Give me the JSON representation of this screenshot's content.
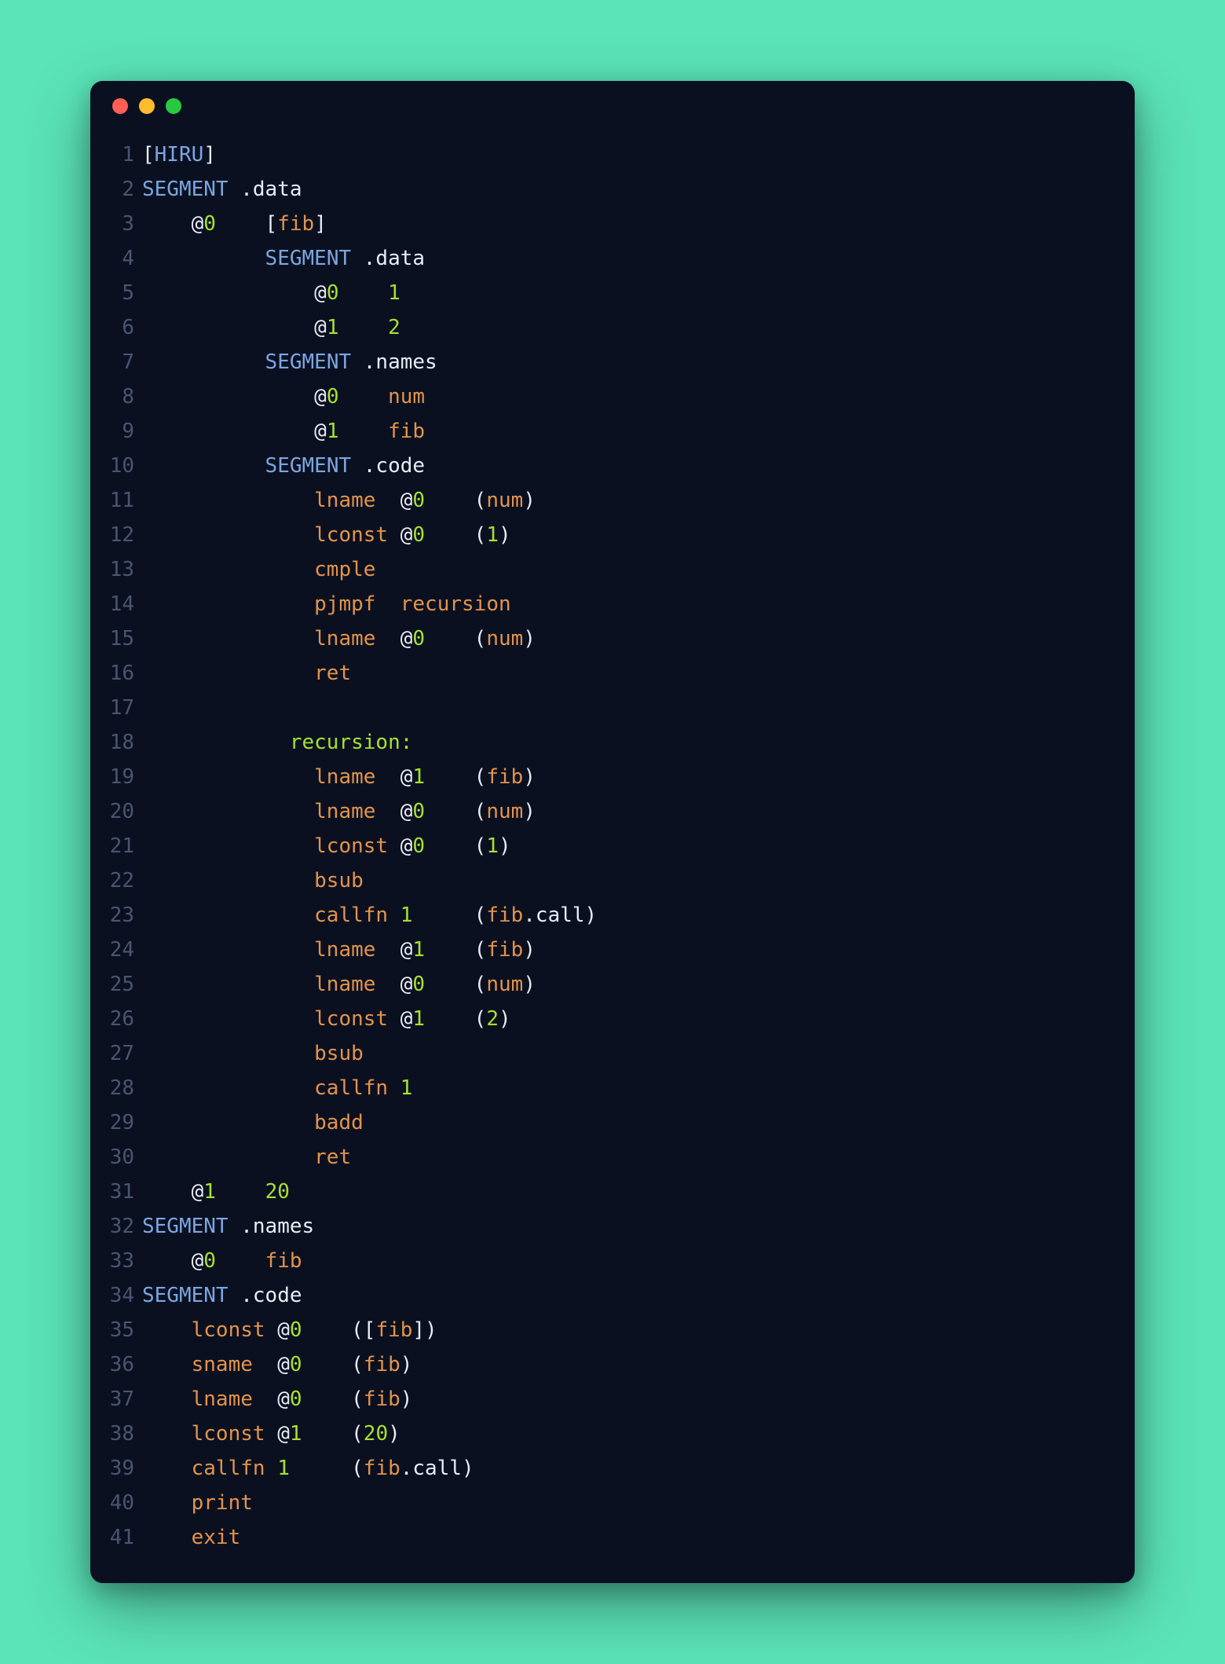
{
  "window": {
    "traffic_lights": [
      "red",
      "yellow",
      "green"
    ]
  },
  "colors": {
    "background_page": "#5be4b8",
    "background_window": "#0b1021",
    "text_default": "#d7dbe6",
    "text_gutter": "#4a5570",
    "syntax": {
      "white": "#e8ecf5",
      "blue": "#7aa7e0",
      "green": "#a6e22e",
      "orange": "#e2944a",
      "gray": "#788097"
    }
  },
  "lines": [
    {
      "n": "1",
      "tokens": [
        {
          "t": "[",
          "c": "white"
        },
        {
          "t": "HIRU",
          "c": "blue"
        },
        {
          "t": "]",
          "c": "white"
        }
      ]
    },
    {
      "n": "2",
      "tokens": [
        {
          "t": "SEGMENT",
          "c": "blue"
        },
        {
          "t": " .data",
          "c": "white"
        }
      ]
    },
    {
      "n": "3",
      "tokens": [
        {
          "t": "    @",
          "c": "white"
        },
        {
          "t": "0",
          "c": "green"
        },
        {
          "t": "    [",
          "c": "white"
        },
        {
          "t": "fib",
          "c": "orange"
        },
        {
          "t": "]",
          "c": "white"
        }
      ]
    },
    {
      "n": "4",
      "tokens": [
        {
          "t": "          ",
          "c": "white"
        },
        {
          "t": "SEGMENT",
          "c": "blue"
        },
        {
          "t": " .data",
          "c": "white"
        }
      ]
    },
    {
      "n": "5",
      "tokens": [
        {
          "t": "              @",
          "c": "white"
        },
        {
          "t": "0",
          "c": "green"
        },
        {
          "t": "    ",
          "c": "white"
        },
        {
          "t": "1",
          "c": "green"
        }
      ]
    },
    {
      "n": "6",
      "tokens": [
        {
          "t": "              @",
          "c": "white"
        },
        {
          "t": "1",
          "c": "green"
        },
        {
          "t": "    ",
          "c": "white"
        },
        {
          "t": "2",
          "c": "green"
        }
      ]
    },
    {
      "n": "7",
      "tokens": [
        {
          "t": "          ",
          "c": "white"
        },
        {
          "t": "SEGMENT",
          "c": "blue"
        },
        {
          "t": " .names",
          "c": "white"
        }
      ]
    },
    {
      "n": "8",
      "tokens": [
        {
          "t": "              @",
          "c": "white"
        },
        {
          "t": "0",
          "c": "green"
        },
        {
          "t": "    ",
          "c": "white"
        },
        {
          "t": "num",
          "c": "orange"
        }
      ]
    },
    {
      "n": "9",
      "tokens": [
        {
          "t": "              @",
          "c": "white"
        },
        {
          "t": "1",
          "c": "green"
        },
        {
          "t": "    ",
          "c": "white"
        },
        {
          "t": "fib",
          "c": "orange"
        }
      ]
    },
    {
      "n": "10",
      "tokens": [
        {
          "t": "          ",
          "c": "white"
        },
        {
          "t": "SEGMENT",
          "c": "blue"
        },
        {
          "t": " .code",
          "c": "white"
        }
      ]
    },
    {
      "n": "11",
      "tokens": [
        {
          "t": "              ",
          "c": "white"
        },
        {
          "t": "lname",
          "c": "orange"
        },
        {
          "t": "  @",
          "c": "white"
        },
        {
          "t": "0",
          "c": "green"
        },
        {
          "t": "    (",
          "c": "white"
        },
        {
          "t": "num",
          "c": "orange"
        },
        {
          "t": ")",
          "c": "white"
        }
      ]
    },
    {
      "n": "12",
      "tokens": [
        {
          "t": "              ",
          "c": "white"
        },
        {
          "t": "lconst",
          "c": "orange"
        },
        {
          "t": " @",
          "c": "white"
        },
        {
          "t": "0",
          "c": "green"
        },
        {
          "t": "    (",
          "c": "white"
        },
        {
          "t": "1",
          "c": "green"
        },
        {
          "t": ")",
          "c": "white"
        }
      ]
    },
    {
      "n": "13",
      "tokens": [
        {
          "t": "              ",
          "c": "white"
        },
        {
          "t": "cmple",
          "c": "orange"
        }
      ]
    },
    {
      "n": "14",
      "tokens": [
        {
          "t": "              ",
          "c": "white"
        },
        {
          "t": "pjmpf",
          "c": "orange"
        },
        {
          "t": "  ",
          "c": "white"
        },
        {
          "t": "recursion",
          "c": "orange"
        }
      ]
    },
    {
      "n": "15",
      "tokens": [
        {
          "t": "              ",
          "c": "white"
        },
        {
          "t": "lname",
          "c": "orange"
        },
        {
          "t": "  @",
          "c": "white"
        },
        {
          "t": "0",
          "c": "green"
        },
        {
          "t": "    (",
          "c": "white"
        },
        {
          "t": "num",
          "c": "orange"
        },
        {
          "t": ")",
          "c": "white"
        }
      ]
    },
    {
      "n": "16",
      "tokens": [
        {
          "t": "              ",
          "c": "white"
        },
        {
          "t": "ret",
          "c": "orange"
        }
      ]
    },
    {
      "n": "17",
      "tokens": [
        {
          "t": "",
          "c": "white"
        }
      ]
    },
    {
      "n": "18",
      "tokens": [
        {
          "t": "            ",
          "c": "white"
        },
        {
          "t": "recursion:",
          "c": "green"
        }
      ]
    },
    {
      "n": "19",
      "tokens": [
        {
          "t": "              ",
          "c": "white"
        },
        {
          "t": "lname",
          "c": "orange"
        },
        {
          "t": "  @",
          "c": "white"
        },
        {
          "t": "1",
          "c": "green"
        },
        {
          "t": "    (",
          "c": "white"
        },
        {
          "t": "fib",
          "c": "orange"
        },
        {
          "t": ")",
          "c": "white"
        }
      ]
    },
    {
      "n": "20",
      "tokens": [
        {
          "t": "              ",
          "c": "white"
        },
        {
          "t": "lname",
          "c": "orange"
        },
        {
          "t": "  @",
          "c": "white"
        },
        {
          "t": "0",
          "c": "green"
        },
        {
          "t": "    (",
          "c": "white"
        },
        {
          "t": "num",
          "c": "orange"
        },
        {
          "t": ")",
          "c": "white"
        }
      ]
    },
    {
      "n": "21",
      "tokens": [
        {
          "t": "              ",
          "c": "white"
        },
        {
          "t": "lconst",
          "c": "orange"
        },
        {
          "t": " @",
          "c": "white"
        },
        {
          "t": "0",
          "c": "green"
        },
        {
          "t": "    (",
          "c": "white"
        },
        {
          "t": "1",
          "c": "green"
        },
        {
          "t": ")",
          "c": "white"
        }
      ]
    },
    {
      "n": "22",
      "tokens": [
        {
          "t": "              ",
          "c": "white"
        },
        {
          "t": "bsub",
          "c": "orange"
        }
      ]
    },
    {
      "n": "23",
      "tokens": [
        {
          "t": "              ",
          "c": "white"
        },
        {
          "t": "callfn",
          "c": "orange"
        },
        {
          "t": " ",
          "c": "white"
        },
        {
          "t": "1",
          "c": "green"
        },
        {
          "t": "     (",
          "c": "white"
        },
        {
          "t": "fib",
          "c": "orange"
        },
        {
          "t": ".call)",
          "c": "white"
        }
      ]
    },
    {
      "n": "24",
      "tokens": [
        {
          "t": "              ",
          "c": "white"
        },
        {
          "t": "lname",
          "c": "orange"
        },
        {
          "t": "  @",
          "c": "white"
        },
        {
          "t": "1",
          "c": "green"
        },
        {
          "t": "    (",
          "c": "white"
        },
        {
          "t": "fib",
          "c": "orange"
        },
        {
          "t": ")",
          "c": "white"
        }
      ]
    },
    {
      "n": "25",
      "tokens": [
        {
          "t": "              ",
          "c": "white"
        },
        {
          "t": "lname",
          "c": "orange"
        },
        {
          "t": "  @",
          "c": "white"
        },
        {
          "t": "0",
          "c": "green"
        },
        {
          "t": "    (",
          "c": "white"
        },
        {
          "t": "num",
          "c": "orange"
        },
        {
          "t": ")",
          "c": "white"
        }
      ]
    },
    {
      "n": "26",
      "tokens": [
        {
          "t": "              ",
          "c": "white"
        },
        {
          "t": "lconst",
          "c": "orange"
        },
        {
          "t": " @",
          "c": "white"
        },
        {
          "t": "1",
          "c": "green"
        },
        {
          "t": "    (",
          "c": "white"
        },
        {
          "t": "2",
          "c": "green"
        },
        {
          "t": ")",
          "c": "white"
        }
      ]
    },
    {
      "n": "27",
      "tokens": [
        {
          "t": "              ",
          "c": "white"
        },
        {
          "t": "bsub",
          "c": "orange"
        }
      ]
    },
    {
      "n": "28",
      "tokens": [
        {
          "t": "              ",
          "c": "white"
        },
        {
          "t": "callfn",
          "c": "orange"
        },
        {
          "t": " ",
          "c": "white"
        },
        {
          "t": "1",
          "c": "green"
        }
      ]
    },
    {
      "n": "29",
      "tokens": [
        {
          "t": "              ",
          "c": "white"
        },
        {
          "t": "badd",
          "c": "orange"
        }
      ]
    },
    {
      "n": "30",
      "tokens": [
        {
          "t": "              ",
          "c": "white"
        },
        {
          "t": "ret",
          "c": "orange"
        }
      ]
    },
    {
      "n": "31",
      "tokens": [
        {
          "t": "    @",
          "c": "white"
        },
        {
          "t": "1",
          "c": "green"
        },
        {
          "t": "    ",
          "c": "white"
        },
        {
          "t": "20",
          "c": "green"
        }
      ]
    },
    {
      "n": "32",
      "tokens": [
        {
          "t": "SEGMENT",
          "c": "blue"
        },
        {
          "t": " .names",
          "c": "white"
        }
      ]
    },
    {
      "n": "33",
      "tokens": [
        {
          "t": "    @",
          "c": "white"
        },
        {
          "t": "0",
          "c": "green"
        },
        {
          "t": "    ",
          "c": "white"
        },
        {
          "t": "fib",
          "c": "orange"
        }
      ]
    },
    {
      "n": "34",
      "tokens": [
        {
          "t": "SEGMENT",
          "c": "blue"
        },
        {
          "t": " .code",
          "c": "white"
        }
      ]
    },
    {
      "n": "35",
      "tokens": [
        {
          "t": "    ",
          "c": "white"
        },
        {
          "t": "lconst",
          "c": "orange"
        },
        {
          "t": " @",
          "c": "white"
        },
        {
          "t": "0",
          "c": "green"
        },
        {
          "t": "    ([",
          "c": "white"
        },
        {
          "t": "fib",
          "c": "orange"
        },
        {
          "t": "])",
          "c": "white"
        }
      ]
    },
    {
      "n": "36",
      "tokens": [
        {
          "t": "    ",
          "c": "white"
        },
        {
          "t": "sname",
          "c": "orange"
        },
        {
          "t": "  @",
          "c": "white"
        },
        {
          "t": "0",
          "c": "green"
        },
        {
          "t": "    (",
          "c": "white"
        },
        {
          "t": "fib",
          "c": "orange"
        },
        {
          "t": ")",
          "c": "white"
        }
      ]
    },
    {
      "n": "37",
      "tokens": [
        {
          "t": "    ",
          "c": "white"
        },
        {
          "t": "lname",
          "c": "orange"
        },
        {
          "t": "  @",
          "c": "white"
        },
        {
          "t": "0",
          "c": "green"
        },
        {
          "t": "    (",
          "c": "white"
        },
        {
          "t": "fib",
          "c": "orange"
        },
        {
          "t": ")",
          "c": "white"
        }
      ]
    },
    {
      "n": "38",
      "tokens": [
        {
          "t": "    ",
          "c": "white"
        },
        {
          "t": "lconst",
          "c": "orange"
        },
        {
          "t": " @",
          "c": "white"
        },
        {
          "t": "1",
          "c": "green"
        },
        {
          "t": "    (",
          "c": "white"
        },
        {
          "t": "20",
          "c": "green"
        },
        {
          "t": ")",
          "c": "white"
        }
      ]
    },
    {
      "n": "39",
      "tokens": [
        {
          "t": "    ",
          "c": "white"
        },
        {
          "t": "callfn",
          "c": "orange"
        },
        {
          "t": " ",
          "c": "white"
        },
        {
          "t": "1",
          "c": "green"
        },
        {
          "t": "     (",
          "c": "white"
        },
        {
          "t": "fib",
          "c": "orange"
        },
        {
          "t": ".call)",
          "c": "white"
        }
      ]
    },
    {
      "n": "40",
      "tokens": [
        {
          "t": "    ",
          "c": "white"
        },
        {
          "t": "print",
          "c": "orange"
        }
      ]
    },
    {
      "n": "41",
      "tokens": [
        {
          "t": "    ",
          "c": "white"
        },
        {
          "t": "exit",
          "c": "orange"
        }
      ]
    }
  ]
}
